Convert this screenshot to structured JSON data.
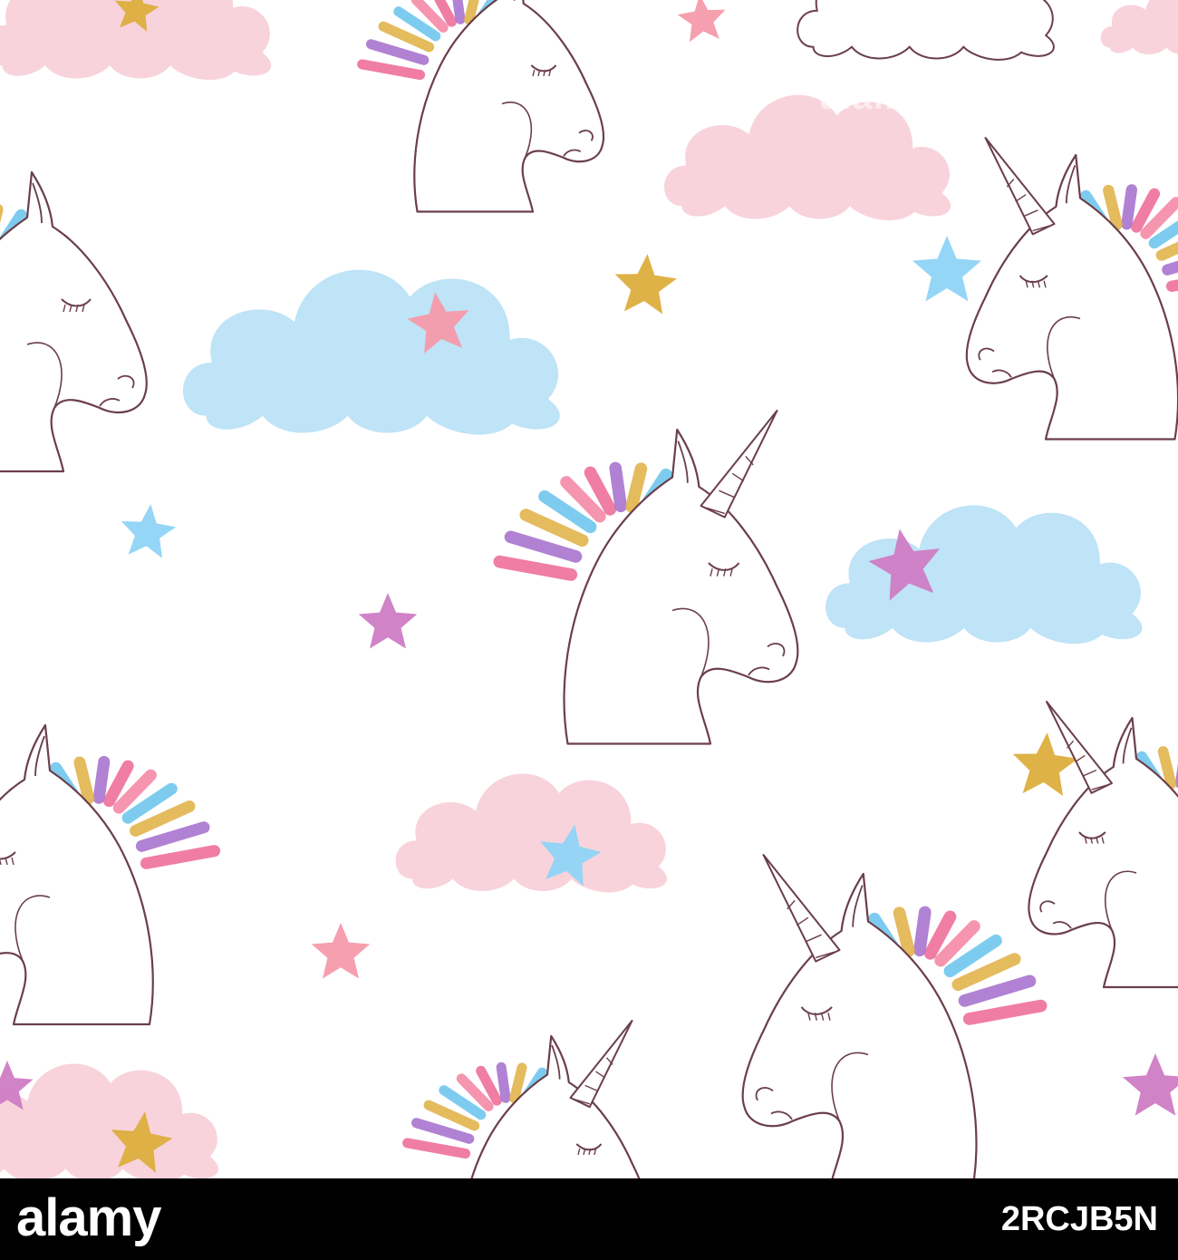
{
  "image": {
    "subject": "seamless pattern of unicorn heads with rainbow manes, pastel clouds and stars",
    "background_color": "#ffffff",
    "outline_color": "#6b3f4a",
    "mane_colors": [
      "#ef6f9a",
      "#a975cf",
      "#e2b44c",
      "#6fc7ee",
      "#f58aa8"
    ],
    "cloud_colors": {
      "pink": "#f8d3dc",
      "blue": "#bfe3f7"
    },
    "star_colors": {
      "gold": "#dcae3c",
      "pink": "#f59aaa",
      "blue": "#8fd4f6",
      "purple": "#cf7cc4"
    },
    "icon_names": [
      "unicorn-head-icon",
      "cloud-icon",
      "star-icon"
    ]
  },
  "watermark": {
    "text": "alamy"
  },
  "footer": {
    "logo": "alamy",
    "image_code": "2RCJB5N"
  }
}
